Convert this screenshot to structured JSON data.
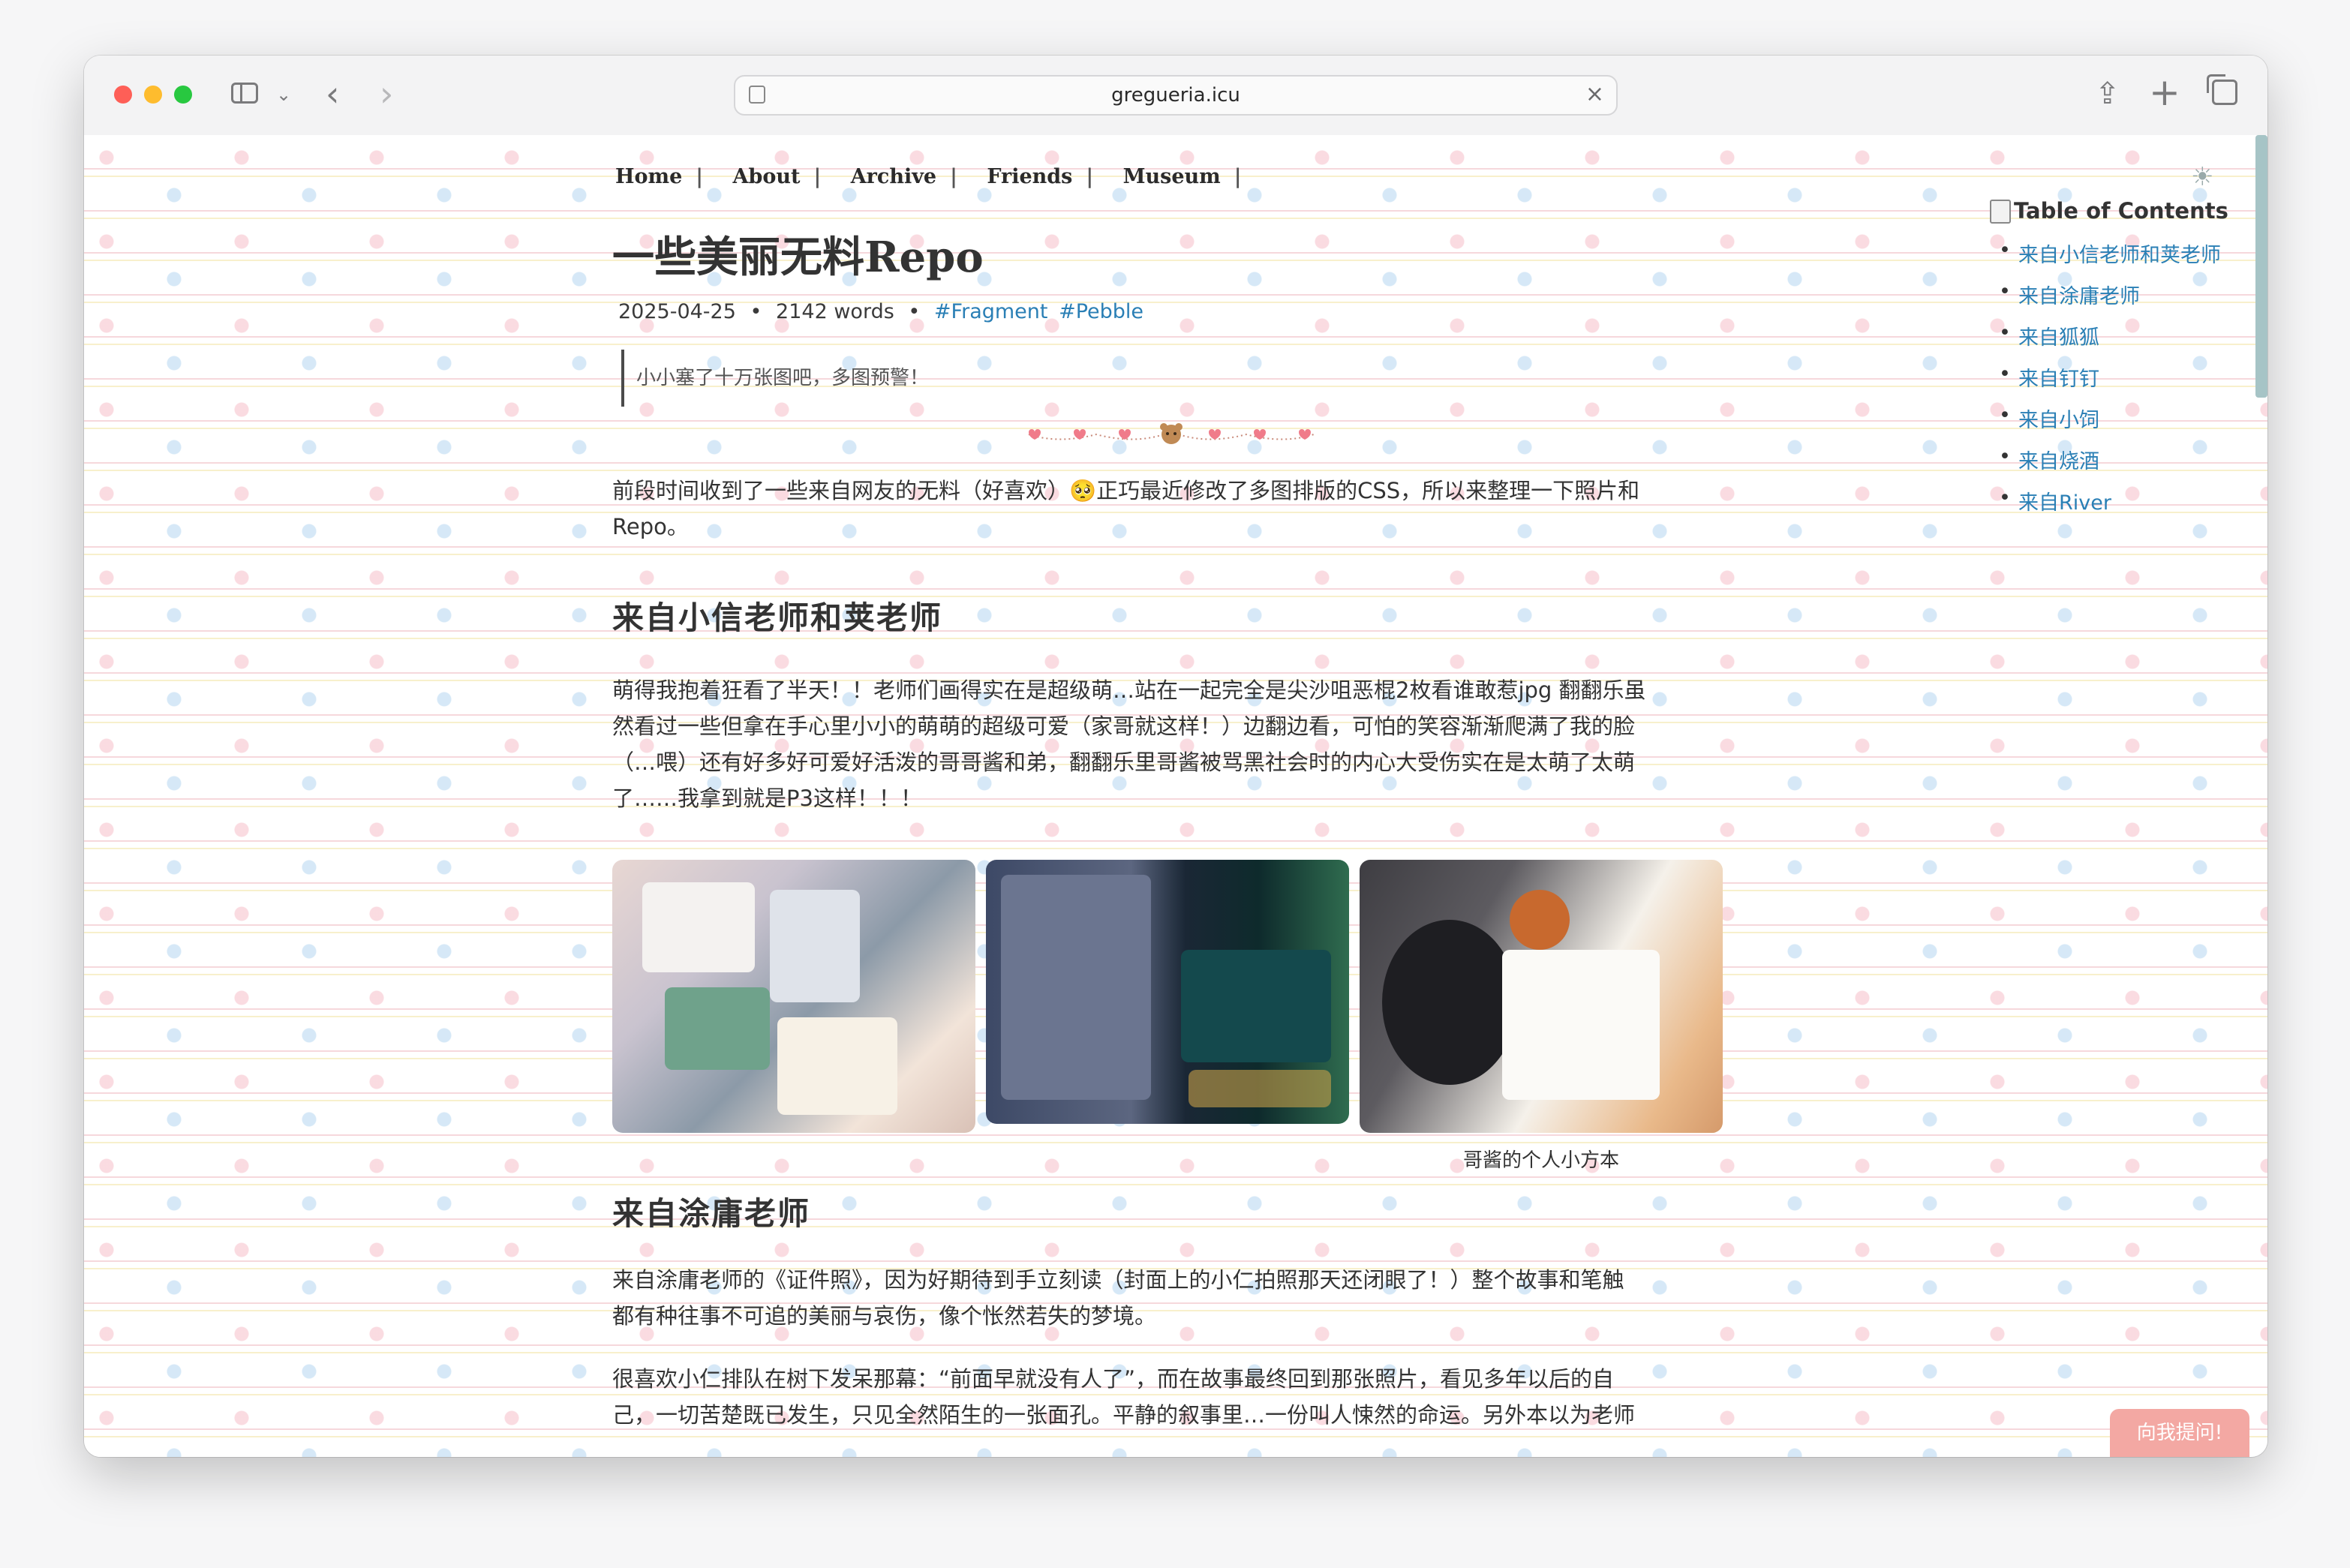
{
  "browser": {
    "url": "gregueria.icu"
  },
  "nav": {
    "items": [
      "Home",
      "About",
      "Archive",
      "Friends",
      "Museum"
    ],
    "separator": "|"
  },
  "post": {
    "title": "一些美丽无料Repo",
    "date": "2025-04-25",
    "dot": "•",
    "words": "2142 words",
    "tags": [
      "#Fragment",
      "#Pebble"
    ],
    "quote": "小小塞了十万张图吧，多图预警！",
    "intro_line1": "前段时间收到了一些来自网友的无料（好喜欢）🥺正巧最近修改了多图排版的CSS，所以来整理一下照片和",
    "intro_line2": "Repo。",
    "section1": {
      "heading": "来自小信老师和荚老师",
      "lines": [
        "萌得我抱着狂看了半天！！老师们画得实在是超级萌…站在一起完全是尖沙咀恶棍2枚看谁敢惹jpg 翻翻乐虽",
        "然看过一些但拿在手心里小小的萌萌的超级可爱（家哥就这样！）边翻边看，可怕的笑容渐渐爬满了我的脸",
        "（…喂）还有好多好可爱好活泼的哥哥酱和弟，翻翻乐里哥酱被骂黑社会时的内心大受伤实在是太萌了太萌",
        "了……我拿到就是P3这样！！！"
      ],
      "caption": "哥酱的个人小方本"
    },
    "section2": {
      "heading": "来自涂庸老师",
      "para1_lines": [
        "来自涂庸老师的《证件照》，因为好期待到手立刻读（封面上的小仁拍照那天还闭眼了！）整个故事和笔触",
        "都有种往事不可追的美丽与哀伤，像个怅然若失的梦境。"
      ],
      "para2_lines": [
        "很喜欢小仁排队在树下发呆那幕：“前面早就没有人了”，而在故事最终回到那张照片，看见多年以后的自",
        "己，一切苦楚既已发生，只见全然陌生的一张面孔。平静的叙事里…一份叫人悚然的命运。另外本以为老师"
      ]
    }
  },
  "toc": {
    "title": "Table of Contents",
    "items": [
      "来自小信老师和荚老师",
      "来自涂庸老师",
      "来自狐狐",
      "来自钉钉",
      "来自小饲",
      "来自烧酒",
      "来自River"
    ]
  },
  "ask_button": "向我提问!",
  "colors": {
    "link": "#2a7fb5",
    "ask_bg": "#f3a8a3",
    "scroll_thumb": "#a6c4c6"
  }
}
